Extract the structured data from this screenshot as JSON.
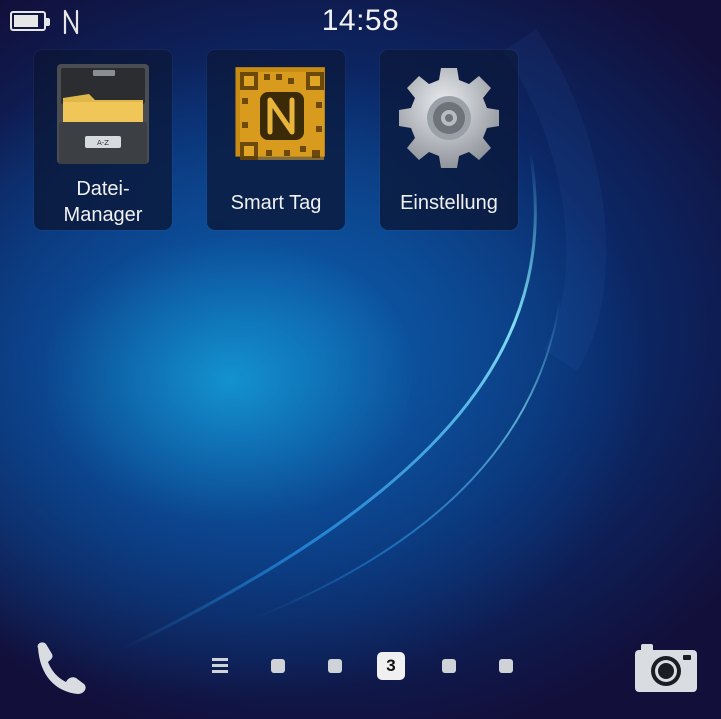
{
  "statusbar": {
    "time": "14:58",
    "battery_level": 0.85,
    "icons": [
      "battery-icon",
      "nfc-icon"
    ]
  },
  "apps": [
    {
      "label_line1": "Datei-",
      "label_line2": "Manager",
      "icon": "file-manager-icon"
    },
    {
      "label": "Smart Tag",
      "icon": "smart-tag-icon"
    },
    {
      "label": "Einstellung",
      "icon": "settings-gear-icon"
    }
  ],
  "dock": {
    "left_icon": "phone-icon",
    "right_icon": "camera-icon",
    "pager": {
      "menu_icon": "menu-lines-icon",
      "current_page": "3",
      "total_pages": 5
    }
  },
  "colors": {
    "text": "#f0f0f0",
    "dot": "#cfd3d8",
    "smart_tag_gold": "#d89a1a"
  }
}
